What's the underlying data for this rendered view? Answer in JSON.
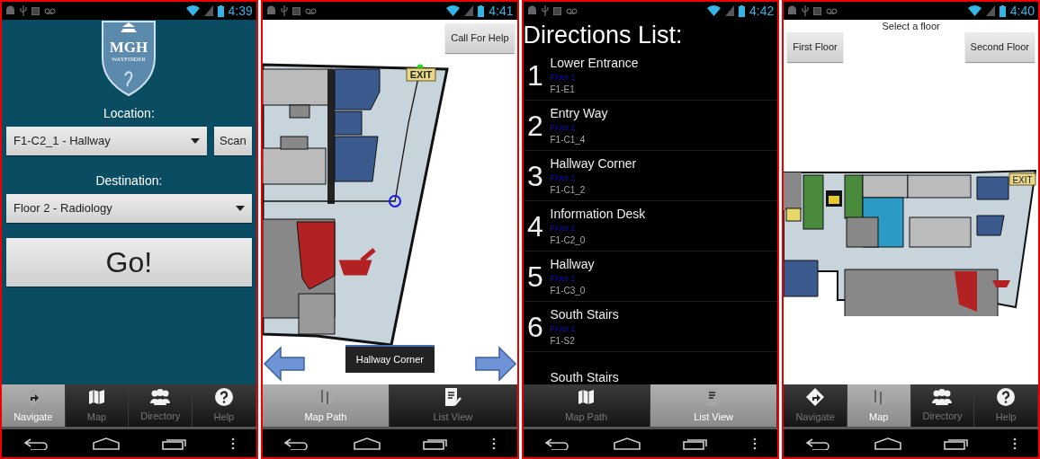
{
  "screens": [
    {
      "kind": "navigate",
      "status_time": "4:39",
      "logo": {
        "title": "MGH",
        "subtitle": "WAYFINDER"
      },
      "location": {
        "label": "Location:",
        "value": "F1-C2_1 - Hallway",
        "button": "Scan"
      },
      "destination": {
        "label": "Destination:",
        "value": "Floor 2 - Radiology"
      },
      "go_button": "Go!",
      "tabs": [
        {
          "label": "Navigate",
          "selected": true
        },
        {
          "label": "Map",
          "selected": false
        },
        {
          "label": "Directory",
          "selected": false
        },
        {
          "label": "Help",
          "selected": false
        }
      ]
    },
    {
      "kind": "map_path",
      "status_time": "4:41",
      "call_button": "Call For Help",
      "exit_sign": "EXIT",
      "toast": "Hallway Corner",
      "tabs": [
        {
          "label": "Map Path",
          "selected": true
        },
        {
          "label": "List View",
          "selected": false
        }
      ]
    },
    {
      "kind": "directions_list",
      "status_time": "4:42",
      "title": "Directions List:",
      "steps": [
        {
          "number": "1",
          "name": "Lower Entrance",
          "floor": "Floor 1",
          "code": "F1-E1"
        },
        {
          "number": "2",
          "name": "Entry Way",
          "floor": "Floor 1",
          "code": "F1-C1_4"
        },
        {
          "number": "3",
          "name": "Hallway Corner",
          "floor": "Floor 1",
          "code": "F1-C1_2"
        },
        {
          "number": "4",
          "name": "Information Desk",
          "floor": "Floor 1",
          "code": "F1-C2_0"
        },
        {
          "number": "5",
          "name": "Hallway",
          "floor": "Floor 1",
          "code": "F1-C3_0"
        },
        {
          "number": "6",
          "name": "South Stairs",
          "floor": "Floor 1",
          "code": "F1-S2"
        },
        {
          "name": "South Stairs"
        }
      ],
      "tabs": [
        {
          "label": "Map Path",
          "selected": false
        },
        {
          "label": "List View",
          "selected": true
        }
      ]
    },
    {
      "kind": "floor_map",
      "status_time": "4:40",
      "prompt": "Select a floor",
      "floor_buttons": [
        "First Floor",
        "Second Floor"
      ],
      "exit_sign": "EXIT",
      "tabs": [
        {
          "label": "Navigate",
          "selected": false
        },
        {
          "label": "Map",
          "selected": true
        },
        {
          "label": "Directory",
          "selected": false
        },
        {
          "label": "Help",
          "selected": false
        }
      ]
    }
  ]
}
